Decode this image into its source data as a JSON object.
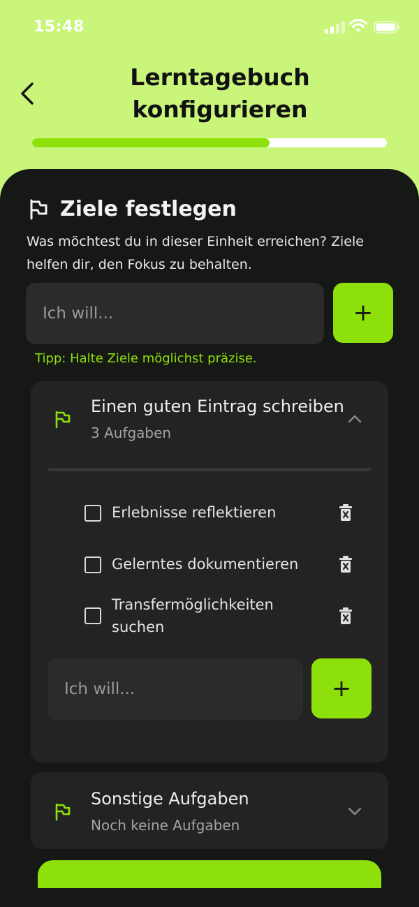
{
  "status_bar": {
    "time": "15:48"
  },
  "header": {
    "title": "Lerntagebuch konfigurieren",
    "back_icon": "chevron-left-icon"
  },
  "progress": {
    "fraction": 0.67
  },
  "section": {
    "icon": "flag-icon",
    "title": "Ziele festlegen",
    "description": "Was möchtest du in dieser Einheit erreichen? Ziele helfen dir, den Fokus zu behalten."
  },
  "goal_input": {
    "placeholder": "Ich will...",
    "add_label": "+"
  },
  "tip": "Tipp: Halte Ziele möglichst präzise.",
  "goals": [
    {
      "title": "Einen guten Eintrag schreiben",
      "subtitle": "3 Aufgaben",
      "expanded": true,
      "tasks": [
        {
          "label": "Erlebnisse reflektieren",
          "checked": false
        },
        {
          "label": "Gelerntes dokumentieren",
          "checked": false
        },
        {
          "label": "Transfermöglichkeiten suchen",
          "checked": false
        }
      ],
      "task_input": {
        "placeholder": "Ich will...",
        "add_label": "+"
      }
    },
    {
      "title": "Sonstige Aufgaben",
      "subtitle": "Noch keine Aufgaben",
      "expanded": false
    }
  ],
  "colors": {
    "accent": "#8ee00a",
    "header_bg": "#c9f57a",
    "sheet_bg": "#161816",
    "card_bg": "#222322",
    "input_bg": "#2a2b2a"
  }
}
